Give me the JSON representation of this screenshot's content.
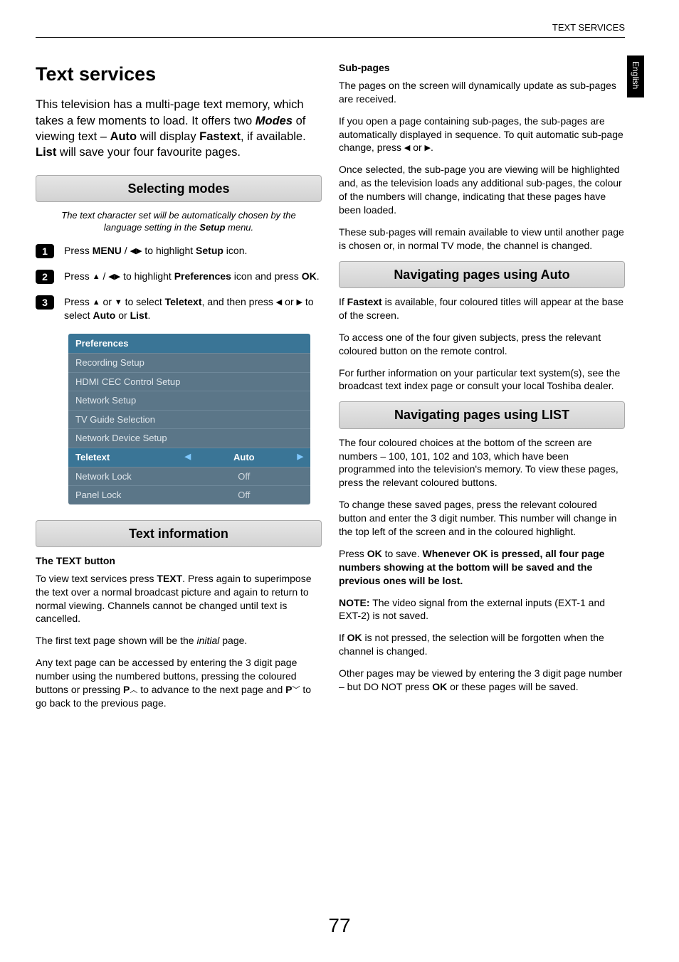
{
  "header": {
    "section": "TEXT SERVICES",
    "lang_tab": "English"
  },
  "title": "Text services",
  "intro_parts": {
    "p1a": "This television has a multi-page text memory, which takes a few moments to load. It offers two ",
    "p1_modes": "Modes",
    "p1b": " of viewing text – ",
    "p1_auto": "Auto",
    "p1c": " will display ",
    "p1_fastext": "Fastext",
    "p1d": ", if available. ",
    "p1_list": "List",
    "p1e": " will save your four favourite pages."
  },
  "sections": {
    "selecting_modes": "Selecting modes",
    "text_information": "Text information",
    "nav_auto": "Navigating pages using Auto",
    "nav_list": "Navigating pages using LIST"
  },
  "selecting_note": {
    "a": "The text character set will be automatically chosen by the language setting in the ",
    "b": "Setup",
    "c": " menu."
  },
  "steps": {
    "s1": {
      "num": "1",
      "a": "Press ",
      "menu": "MENU",
      "b": " / ",
      "c": " to highlight ",
      "setup": "Setup",
      "d": " icon."
    },
    "s2": {
      "num": "2",
      "a": "Press ",
      "b": " / ",
      "c": " to highlight ",
      "pref": "Preferences",
      "d": " icon and press ",
      "ok": "OK",
      "e": "."
    },
    "s3": {
      "num": "3",
      "a": "Press ",
      "b": " or ",
      "c": " to select ",
      "tele": "Teletext",
      "d": ", and then press ",
      "e": " or ",
      "f": " to select ",
      "auto": "Auto",
      "g": " or ",
      "list": "List",
      "h": "."
    }
  },
  "menu": {
    "header": "Preferences",
    "rows": [
      {
        "label": "Recording Setup"
      },
      {
        "label": "HDMI CEC Control Setup"
      },
      {
        "label": "Network Setup"
      },
      {
        "label": "TV Guide Selection"
      },
      {
        "label": "Network Device Setup"
      },
      {
        "label": "Teletext",
        "value": "Auto",
        "active": true
      },
      {
        "label": "Network Lock",
        "value": "Off"
      },
      {
        "label": "Panel Lock",
        "value": "Off"
      }
    ]
  },
  "text_info": {
    "h1": "The TEXT button",
    "p1a": "To view text services press ",
    "p1b": "TEXT",
    "p1c": ". Press again to superimpose the text over a normal broadcast picture and again to return to normal viewing. Channels cannot be changed until text is cancelled.",
    "p2a": "The first text page shown will be the ",
    "p2b": "initial",
    "p2c": " page.",
    "p3a": "Any text page can be accessed by entering the 3 digit page number using the numbered buttons, pressing the coloured buttons or pressing ",
    "p3b": "P",
    "p3c": " to advance to the next page and ",
    "p3d": "P",
    "p3e": " to go back to the previous page.",
    "h2": "Sub-pages",
    "p4": "The pages on the screen will dynamically update as sub-pages are received.",
    "p5a": "If you open a page containing sub-pages, the sub-pages are automatically displayed in sequence. To quit automatic sub-page change, press ",
    "p5b": " or ",
    "p5c": ".",
    "p6": "Once selected, the sub-page you are viewing will be highlighted and, as the television loads any additional sub-pages, the colour of the numbers will change, indicating that these pages have been loaded.",
    "p7": "These sub-pages will remain available to view until another page is chosen or, in normal TV mode, the channel is changed."
  },
  "nav_auto_body": {
    "p1a": "If ",
    "p1b": "Fastext",
    "p1c": " is available, four coloured titles will appear at the base of the screen.",
    "p2": "To access one of the four given subjects, press the relevant coloured button on the remote control.",
    "p3": "For further information on your particular text system(s), see the broadcast text index page or consult your local Toshiba dealer."
  },
  "nav_list_body": {
    "p1": "The four coloured choices at the bottom of the screen are numbers – 100, 101, 102 and 103, which have been programmed into the television's memory. To view these pages, press the relevant coloured buttons.",
    "p2": "To change these saved pages, press the relevant coloured button and enter the 3 digit number. This number will change in the top left of the screen and in the coloured highlight.",
    "p3a": "Press ",
    "p3b": "OK",
    "p3c": " to save. ",
    "p3d": "Whenever OK is pressed, all four page numbers showing at the bottom will be saved and the previous ones will be lost.",
    "p4a": "NOTE:",
    "p4b": " The video signal from the external inputs (EXT-1 and EXT-2) is not saved.",
    "p5a": "If ",
    "p5b": "OK",
    "p5c": " is not pressed, the selection will be forgotten when the channel is changed.",
    "p6a": "Other pages may be viewed by entering the 3 digit page number – but DO NOT press ",
    "p6b": "OK",
    "p6c": " or these pages will be saved."
  },
  "page_number": "77"
}
